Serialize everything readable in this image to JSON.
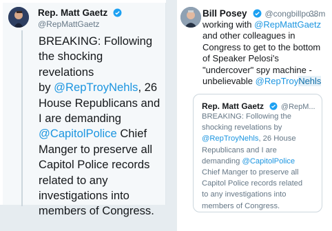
{
  "left_tweet": {
    "name": "Rep. Matt Gaetz",
    "handle": "@RepMattGaetz",
    "text_lines": [
      "BREAKING: Following",
      "the shocking revelations",
      "by ",
      "House Republicans and",
      "I are demanding",
      " Chief",
      "Manger to preserve all",
      "Capitol Police records",
      "related to any",
      "investigations into",
      "members of Congress."
    ],
    "mention_nehls": "@RepTroyNehls",
    "after_nehls": ", 26",
    "mention_police": "@CapitolPolice"
  },
  "right_tweet": {
    "name": "Bill Posey",
    "handle": "@congbillpo...",
    "time": "38m",
    "line1_pre": "working with ",
    "mention_gaetz": "@RepMattGaetz",
    "lines": [
      "and other colleagues in",
      "Congress to get to the bottom",
      "of Speaker Pelosi's",
      "\"undercover\" spy machine -",
      "unbelievable  "
    ],
    "mention_troy": "@RepTroy",
    "mention_nehls_tail": "Nehls",
    "quote": {
      "name": "Rep. Matt Gaetz",
      "handle": "@RepM...",
      "lines_a": [
        "BREAKING: Following the",
        "shocking revelations by"
      ],
      "mention_nehls": "@RepTroyNehls",
      "after_nehls": ", 26 House",
      "line_rep": "Republicans and I are",
      "demanding": "demanding ",
      "mention_police": "@CapitolPolice",
      "lines_b": [
        "Chief Manger to preserve all",
        "Capitol Police records related",
        "to any investigations into",
        "members of Congress."
      ]
    }
  },
  "colors": {
    "accent": "#1b95e0",
    "text": "#14171a",
    "muted": "#657786"
  },
  "icons": [
    "verified-badge-icon"
  ]
}
